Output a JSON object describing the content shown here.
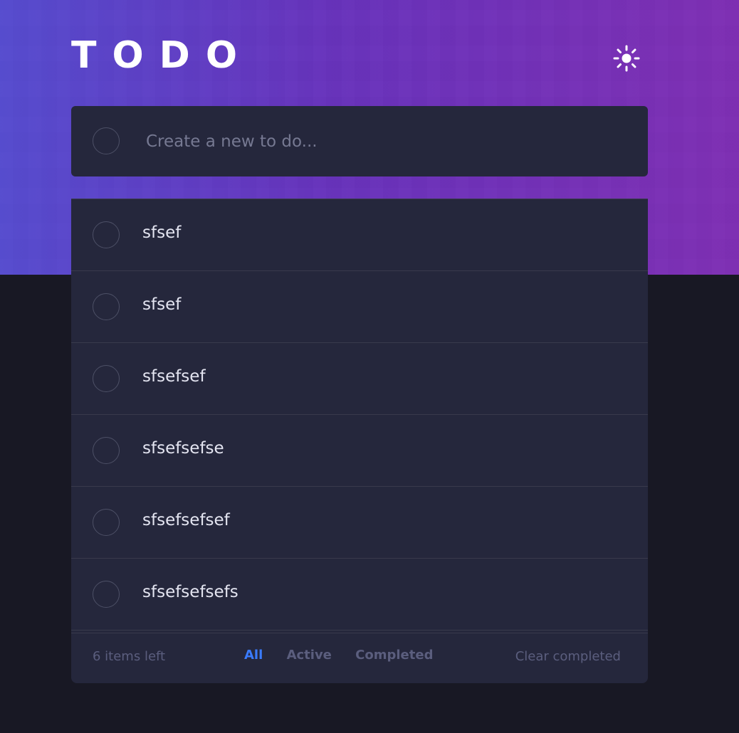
{
  "header": {
    "title": "TODO",
    "theme_toggle_icon": "sun-icon"
  },
  "new_todo": {
    "placeholder": "Create a new to do...",
    "value": ""
  },
  "todos": [
    {
      "text": "sfsef",
      "completed": false
    },
    {
      "text": "sfsef",
      "completed": false
    },
    {
      "text": "sfsefsef",
      "completed": false
    },
    {
      "text": "sfsefsefse",
      "completed": false
    },
    {
      "text": "sfsefsefsef",
      "completed": false
    },
    {
      "text": "sfsefsefsefs",
      "completed": false
    }
  ],
  "footer": {
    "items_left": "6 items left",
    "filters": [
      "All",
      "Active",
      "Completed"
    ],
    "active_filter": "All",
    "clear_completed": "Clear completed"
  },
  "colors": {
    "background": "#181824",
    "card": "#25273c",
    "accent": "#3a7bfd",
    "muted_text": "#5b5e7e"
  }
}
